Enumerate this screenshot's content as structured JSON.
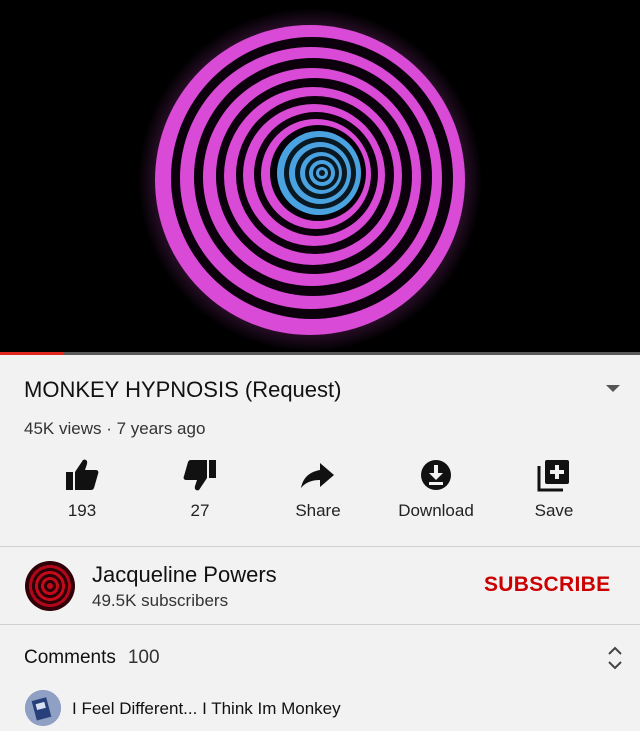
{
  "video": {
    "progress_fraction": 0.1,
    "colors": {
      "ring": "#d94ad6",
      "core": "#4aa3e0",
      "background": "#000000",
      "progress": "#e0281e"
    }
  },
  "title": "MONKEY HYPNOSIS (Request)",
  "meta": "45K views · 7 years ago",
  "actions": {
    "like_count": "193",
    "dislike_count": "27",
    "share_label": "Share",
    "download_label": "Download",
    "save_label": "Save"
  },
  "channel": {
    "name": "Jacqueline Powers",
    "subscribers": "49.5K subscribers",
    "subscribe_label": "SUBSCRIBE"
  },
  "comments": {
    "label": "Comments",
    "count": "100",
    "first_comment": "I Feel Different... I Think Im Monkey"
  },
  "icons": {
    "like": "thumbs-up-icon",
    "dislike": "thumbs-down-icon",
    "share": "share-arrow-icon",
    "download": "download-icon",
    "save": "add-to-playlist-icon",
    "expand": "chevron-down-icon",
    "sort": "expand-collapse-icon"
  }
}
